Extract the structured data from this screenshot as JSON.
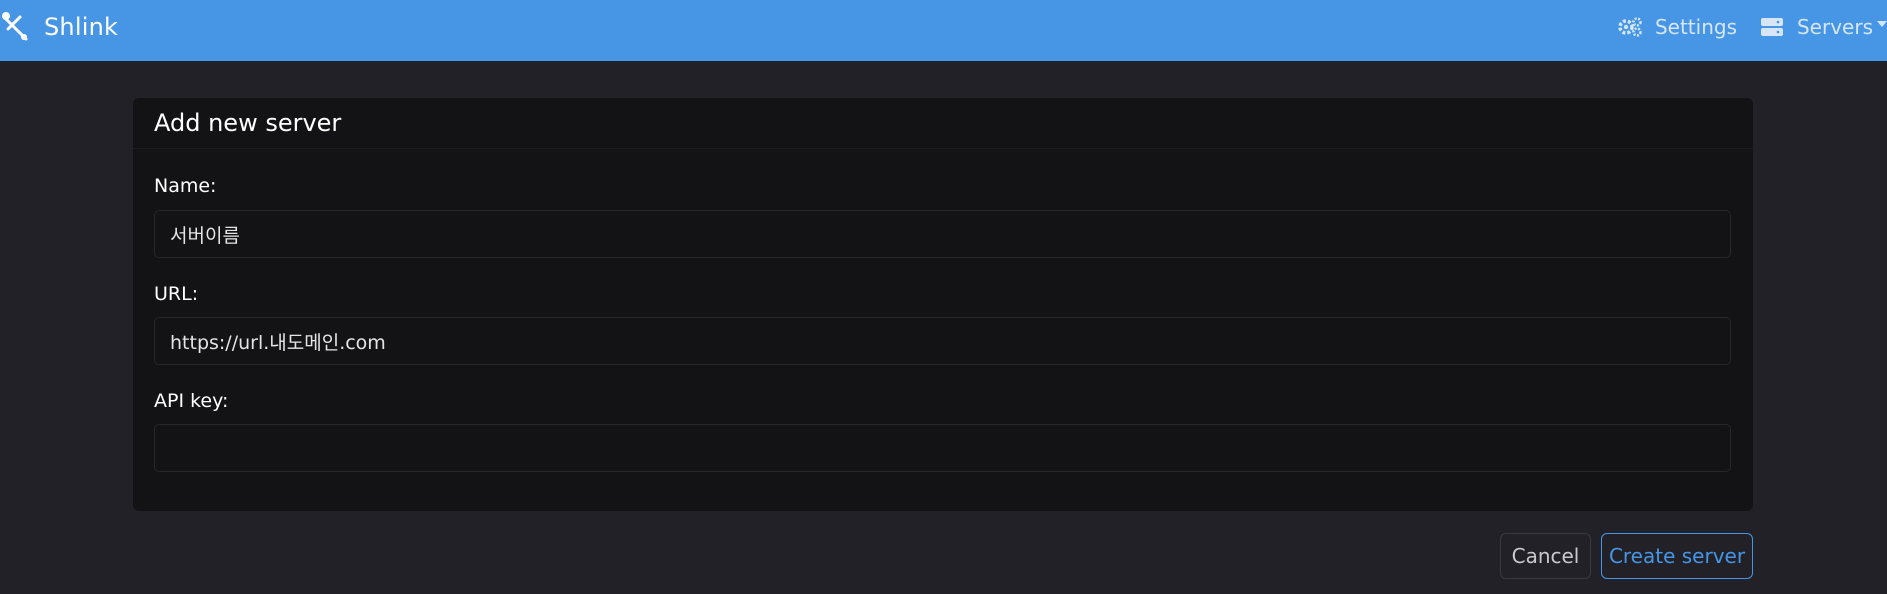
{
  "app": {
    "brand_name": "Shlink",
    "brand_icon": "wrench-link-icon",
    "accent_color": "#4696e5"
  },
  "nav": {
    "settings_label": "Settings",
    "settings_icon": "gears-icon",
    "servers_label": "Servers",
    "servers_icon": "server-icon"
  },
  "form": {
    "title": "Add new server",
    "name_label": "Name:",
    "name_value": "서버이름",
    "url_label": "URL:",
    "url_value": "https://url.내도메인.com",
    "apikey_label": "API key:",
    "apikey_value": ""
  },
  "actions": {
    "cancel_label": "Cancel",
    "create_label": "Create server"
  }
}
